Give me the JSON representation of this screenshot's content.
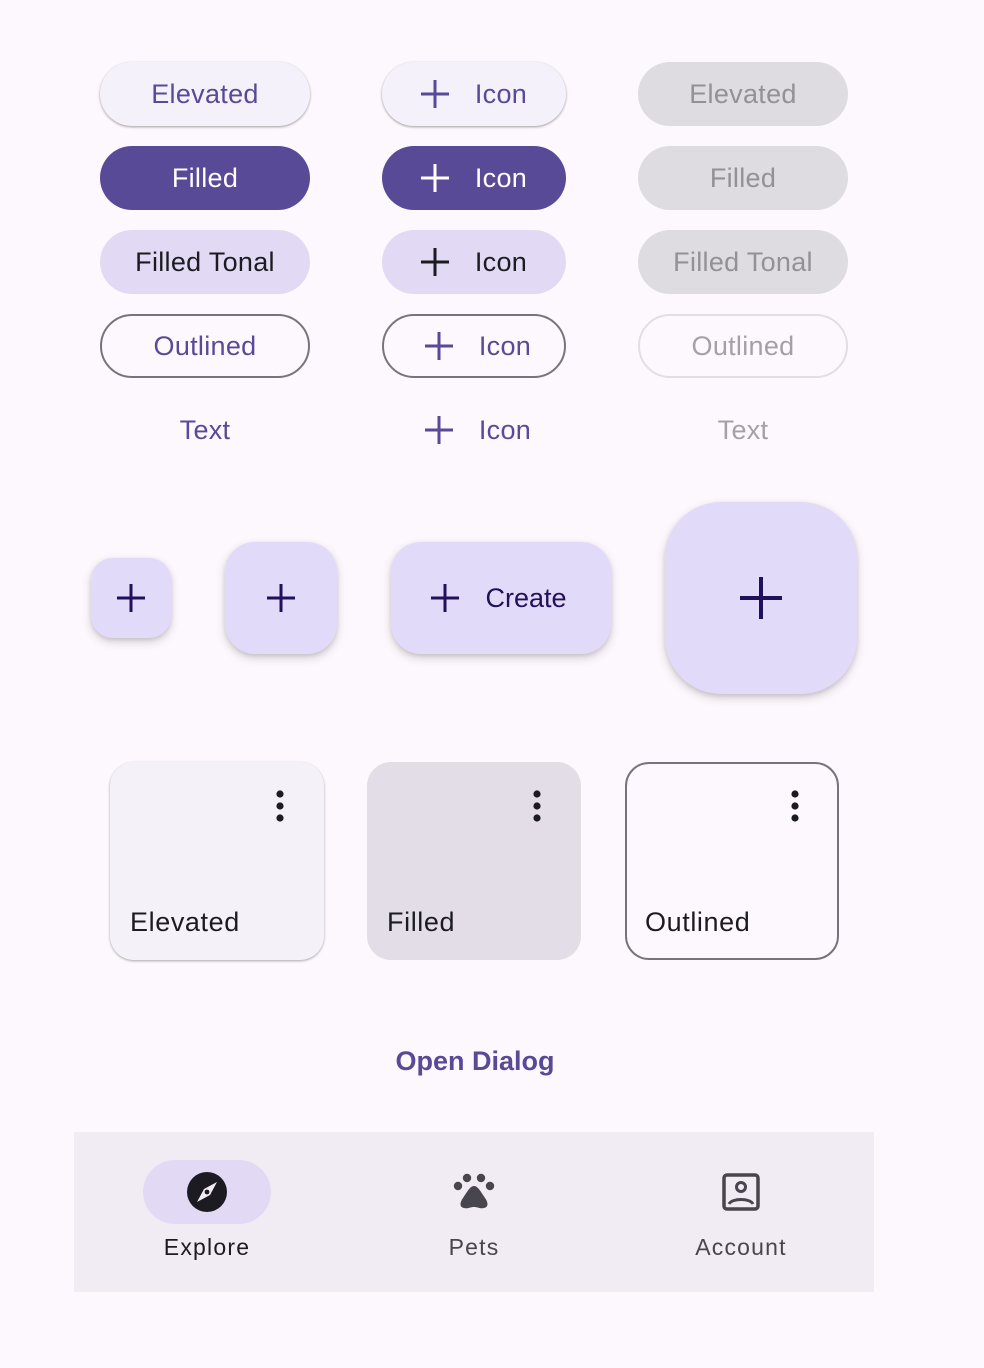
{
  "colors": {
    "primary": "#584a96",
    "on_primary": "#ffffff",
    "secondary_container": "#e2daf4",
    "primary_container": "#e2daf9",
    "on_primary_container": "#22105a",
    "surface": "#fdf8fd",
    "outline": "#78747e",
    "disabled_container": "#dedce0",
    "disabled_text": "#939196",
    "nav_bar": "#f1ebf4"
  },
  "buttons": {
    "enabled": {
      "elevated": "Elevated",
      "filled": "Filled",
      "tonal": "Filled Tonal",
      "outlined": "Outlined",
      "text": "Text"
    },
    "icon": {
      "elevated": "Icon",
      "filled": "Icon",
      "tonal": "Icon",
      "outlined": "Icon",
      "text": "Icon",
      "icon_name": "add-icon"
    },
    "disabled": {
      "elevated": "Elevated",
      "filled": "Filled",
      "tonal": "Filled Tonal",
      "outlined": "Outlined",
      "text": "Text"
    }
  },
  "fabs": {
    "small": {
      "icon": "add-icon"
    },
    "regular": {
      "icon": "add-icon"
    },
    "extended": {
      "icon": "add-icon",
      "label": "Create"
    },
    "large": {
      "icon": "add-icon"
    }
  },
  "cards": [
    {
      "label": "Elevated",
      "variant": "elevated",
      "menu_icon": "more-vert-icon"
    },
    {
      "label": "Filled",
      "variant": "filled",
      "menu_icon": "more-vert-icon"
    },
    {
      "label": "Outlined",
      "variant": "outlined",
      "menu_icon": "more-vert-icon"
    }
  ],
  "dialog": {
    "open_label": "Open Dialog"
  },
  "navigation": {
    "items": [
      {
        "label": "Explore",
        "icon": "explore-icon",
        "selected": true
      },
      {
        "label": "Pets",
        "icon": "pets-icon",
        "selected": false
      },
      {
        "label": "Account",
        "icon": "account-box-icon",
        "selected": false
      }
    ]
  }
}
